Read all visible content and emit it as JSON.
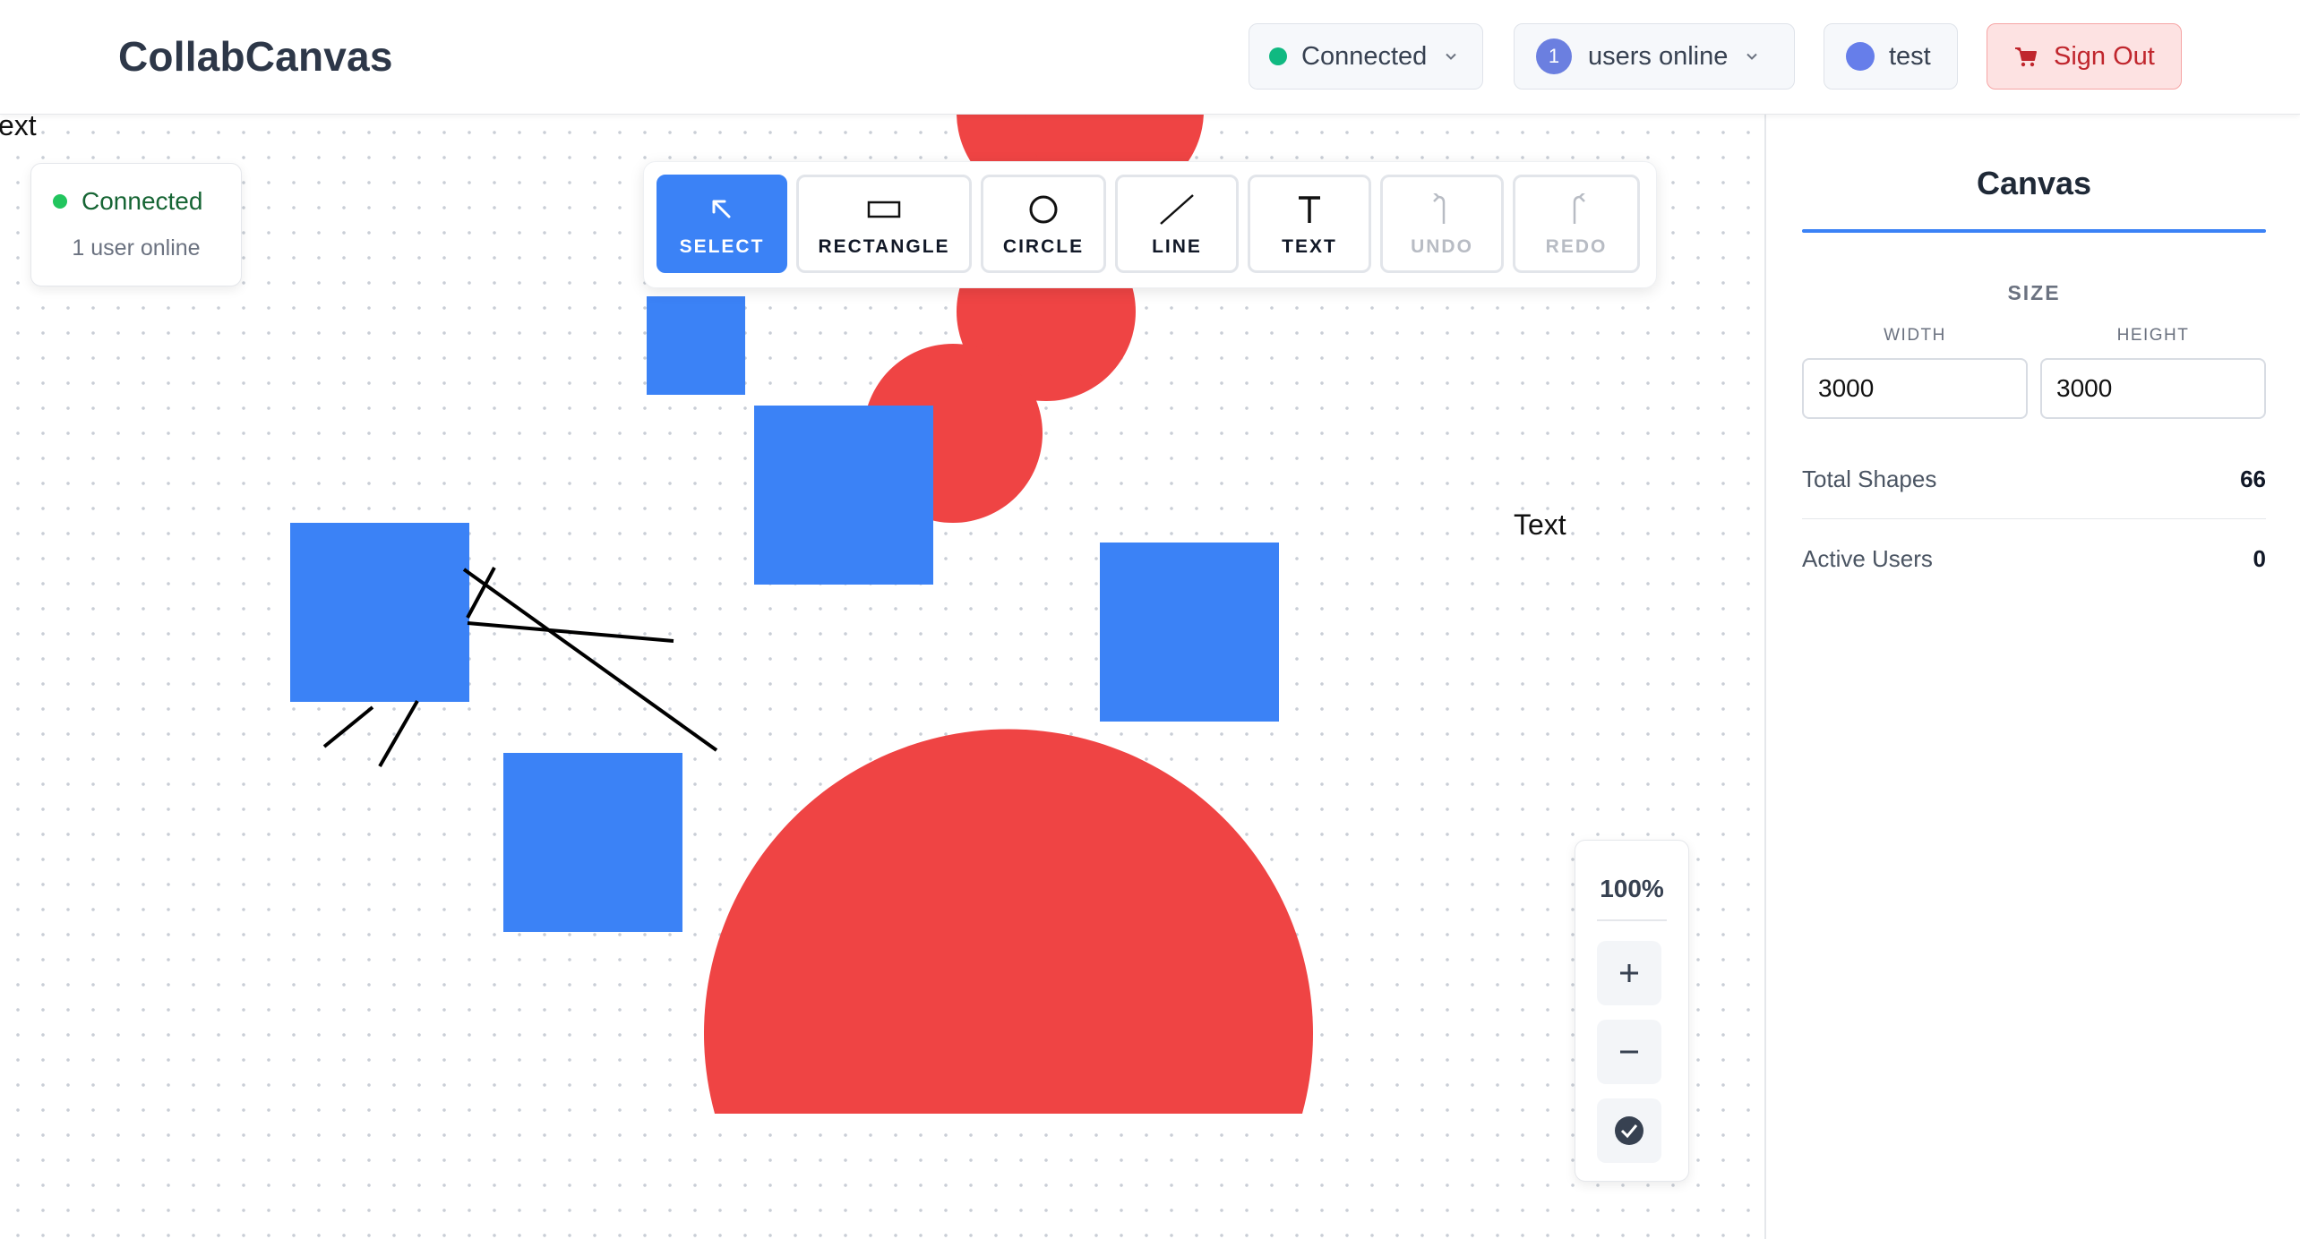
{
  "header": {
    "app_title": "CollabCanvas",
    "connection_label": "Connected",
    "users_count": "1",
    "users_label": "users online",
    "user_name": "test",
    "signout_label": "Sign Out"
  },
  "status_card": {
    "status": "Connected",
    "users": "1 user online"
  },
  "toolbar": {
    "tools": [
      {
        "label": "SELECT",
        "icon": "cursor-arrow-icon",
        "state": "active"
      },
      {
        "label": "RECTANGLE",
        "icon": "rectangle-icon",
        "state": "enabled"
      },
      {
        "label": "CIRCLE",
        "icon": "circle-icon",
        "state": "enabled"
      },
      {
        "label": "LINE",
        "icon": "line-icon",
        "state": "enabled"
      },
      {
        "label": "TEXT",
        "icon": "text-icon",
        "state": "enabled"
      },
      {
        "label": "UNDO",
        "icon": "undo-icon",
        "state": "disabled"
      },
      {
        "label": "REDO",
        "icon": "redo-icon",
        "state": "disabled"
      }
    ]
  },
  "canvas": {
    "texts": [
      "ext",
      "Text"
    ],
    "shape_colors": {
      "rectangle": "#3b82f6",
      "circle": "#ef4444",
      "line": "#000000"
    }
  },
  "zoom": {
    "level": "100%",
    "zoom_in": "+",
    "zoom_out": "−"
  },
  "sidebar": {
    "tab": "Canvas",
    "size_heading": "SIZE",
    "width_label": "WIDTH",
    "height_label": "HEIGHT",
    "width_value": "3000",
    "height_value": "3000",
    "total_shapes_label": "Total Shapes",
    "total_shapes_value": "66",
    "active_users_label": "Active Users",
    "active_users_value": "0"
  },
  "colors": {
    "accent": "#3b82f6",
    "connected": "#10b981",
    "signout_bg": "#fde2e2",
    "signout_text": "#c0262d"
  }
}
